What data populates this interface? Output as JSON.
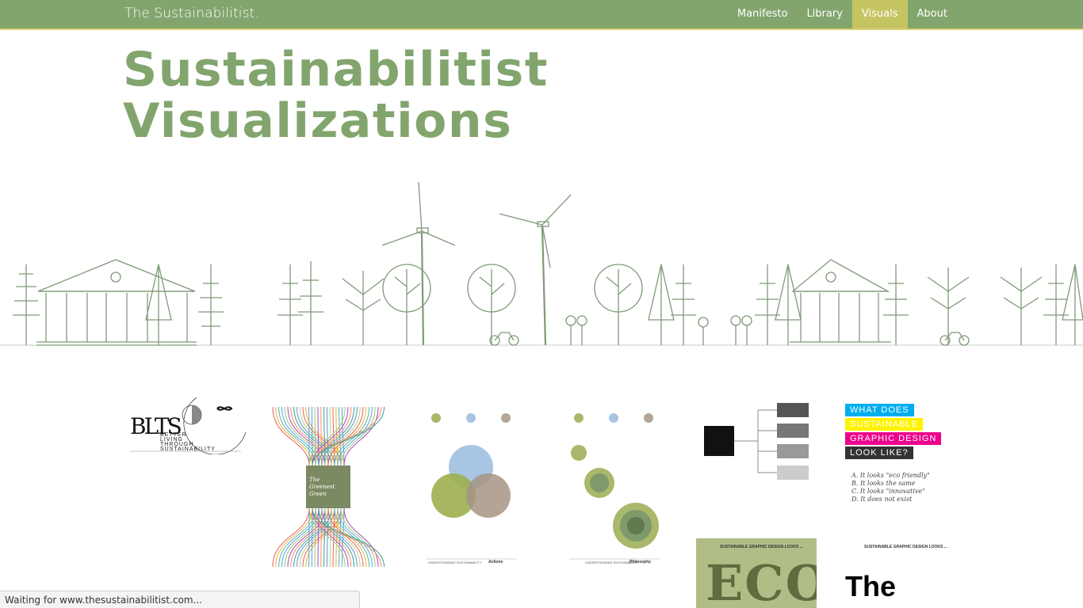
{
  "nav": {
    "brand": "The Sustainabilitist.",
    "items": [
      {
        "label": "Manifesto"
      },
      {
        "label": "Library"
      },
      {
        "label": "Visuals",
        "active": true
      },
      {
        "label": "About"
      }
    ]
  },
  "page": {
    "title_line1": "Sustainabilitist",
    "title_line2": "Visualizations"
  },
  "gallery": {
    "blts": {
      "logo": "BLTS",
      "tagline": [
        "BETTER",
        "LIVING",
        "THROUGH",
        "SUSTAINABILITY"
      ]
    },
    "greenest": {
      "title_line1": "The",
      "title_line2": "Greenest",
      "title_line3": "Green"
    },
    "actions": {
      "caption_prefix": "UNDERSTANDING SUSTAINABILITY",
      "caption": "Actions"
    },
    "philosophy": {
      "caption_prefix": "UNDERSTANDING SUSTAINABILITY",
      "caption": "Philosophy"
    },
    "sgd": {
      "lines": [
        "WHAT DOES",
        "SUSTAINABLE",
        "GRAPHIC DESIGN",
        "LOOK LIKE?"
      ],
      "answers": [
        "A. It looks \"eco friendly\"",
        "B. It looks the same",
        "C. It looks \"innovative\"",
        "D. It does not exist"
      ]
    },
    "eco": {
      "header": "SUSTAINABLE GRAPHIC DESIGN LOOKS ...",
      "word": "ECO"
    },
    "the_same": {
      "header": "SUSTAINABLE GRAPHIC DESIGN LOOKS ...",
      "word": "The"
    }
  },
  "status": {
    "text": "Waiting for www.thesustainabilitist.com..."
  },
  "colors": {
    "nav_bg": "#82a56d",
    "nav_active": "#c5c462",
    "title": "#82a56d",
    "illustration": "#7f9a78"
  }
}
